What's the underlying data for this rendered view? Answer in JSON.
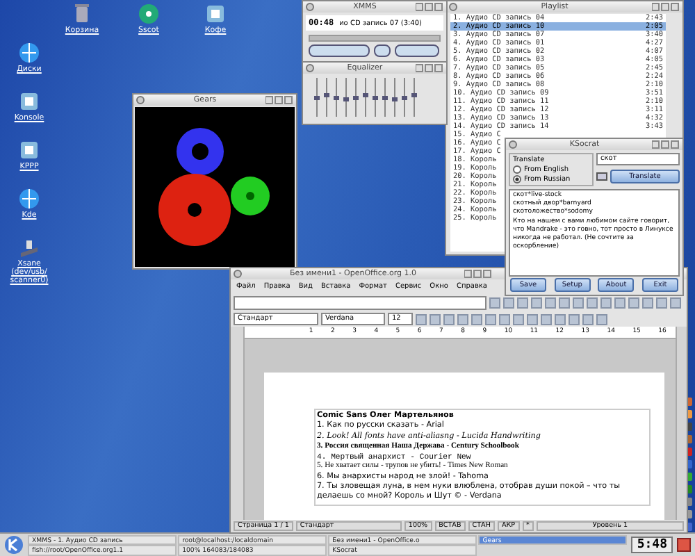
{
  "desktop_icons": [
    {
      "label": "Корзина",
      "kind": "trash"
    },
    {
      "label": "Sscot",
      "kind": "disc"
    },
    {
      "label": "Кофе",
      "kind": "app"
    },
    {
      "label": "Диски",
      "kind": "globe"
    },
    {
      "label": "Konsole",
      "kind": "app"
    },
    {
      "label": "KPPP",
      "kind": "app"
    },
    {
      "label": "Kde",
      "kind": "globe"
    },
    {
      "label": "Xsane (dev/usb/ scanner0)",
      "kind": "scanner"
    }
  ],
  "gears_window": {
    "title": "Gears"
  },
  "xmms": {
    "title": "XMMS",
    "time": "00:48",
    "song": "ио CD запись 07 (3:40)"
  },
  "equalizer": {
    "title": "Equalizer",
    "bands": [
      {
        "level": 0.5
      },
      {
        "level": 0.55
      },
      {
        "level": 0.5
      },
      {
        "level": 0.45
      },
      {
        "level": 0.5
      },
      {
        "level": 0.55
      },
      {
        "level": 0.5
      },
      {
        "level": 0.5
      },
      {
        "level": 0.45
      },
      {
        "level": 0.5
      },
      {
        "level": 0.55
      }
    ]
  },
  "playlist": {
    "title": "Playlist",
    "rows": [
      {
        "label": "1. Аудио CD запись 04",
        "time": "2:43",
        "selected": false
      },
      {
        "label": "2. Аудио CD запись 10",
        "time": "2:05",
        "selected": true
      },
      {
        "label": "3. Аудио CD запись 07",
        "time": "3:40",
        "selected": false
      },
      {
        "label": "4. Аудио CD запись 01",
        "time": "4:27",
        "selected": false
      },
      {
        "label": "5. Аудио CD запись 02",
        "time": "4:07",
        "selected": false
      },
      {
        "label": "6. Аудио CD запись 03",
        "time": "4:05",
        "selected": false
      },
      {
        "label": "7. Аудио CD запись 05",
        "time": "2:45",
        "selected": false
      },
      {
        "label": "8. Аудио CD запись 06",
        "time": "2:24",
        "selected": false
      },
      {
        "label": "9. Аудио CD запись 08",
        "time": "2:10",
        "selected": false
      },
      {
        "label": "10. Аудио CD запись 09",
        "time": "3:51",
        "selected": false
      },
      {
        "label": "11. Аудио CD запись 11",
        "time": "2:10",
        "selected": false
      },
      {
        "label": "12. Аудио CD запись 12",
        "time": "3:11",
        "selected": false
      },
      {
        "label": "13. Аудио CD запись 13",
        "time": "4:32",
        "selected": false
      },
      {
        "label": "14. Аудио CD запись 14",
        "time": "3:43",
        "selected": false
      },
      {
        "label": "15. Аудио С",
        "selected": false
      },
      {
        "label": "16. Аудио С",
        "selected": false
      },
      {
        "label": "17. Аудио С",
        "selected": false
      },
      {
        "label": "18. Король",
        "selected": false
      },
      {
        "label": "19. Король",
        "selected": false
      },
      {
        "label": "20. Король",
        "selected": false
      },
      {
        "label": "21. Король",
        "selected": false
      },
      {
        "label": "22. Король",
        "selected": false
      },
      {
        "label": "23. Король",
        "selected": false
      },
      {
        "label": "24. Король",
        "selected": false
      },
      {
        "label": "25. Король",
        "selected": false
      }
    ]
  },
  "ksocrat": {
    "title": "KSocrat",
    "group": "Translate",
    "radios": [
      {
        "label": "From English",
        "selected": false
      },
      {
        "label": "From Russian",
        "selected": true
      }
    ],
    "query": "скот",
    "translate_button": "Translate",
    "results": [
      "скот*live-stock",
      "скотный двор*barnyard",
      "скотоложество*sodomy",
      "Кто на нашем с вами любимом сайте говорит, что Mandrake - это говно, тот просто в Линуксе никогда не работал. (Не сочтите за оскорбление)"
    ],
    "buttons": [
      "Save",
      "Setup",
      "About",
      "Exit"
    ]
  },
  "writer": {
    "title": "Без имени1 - OpenOffice.org 1.0",
    "menu": [
      "Файл",
      "Правка",
      "Вид",
      "Вставка",
      "Формат",
      "Сервис",
      "Окно",
      "Справка"
    ],
    "style": "Стандарт",
    "font": "Verdana",
    "size": "12",
    "ruler": [
      "1",
      "2",
      "3",
      "4",
      "5",
      "6",
      "7",
      "8",
      "9",
      "10",
      "11",
      "12",
      "13",
      "14",
      "15",
      "16"
    ],
    "lines": [
      {
        "text": "Comic  Sans Олег Мартельянов",
        "kind": "comic"
      },
      {
        "text": "1. Как по русски сказать - Arial",
        "kind": "sans"
      },
      {
        "text": "2. Look! All fonts have anti-aliasng  -  Lucida Handwriting",
        "kind": "hand"
      },
      {
        "text": "3. Россия священная Наша Держава  -  Century Schoolbook",
        "kind": "serifbold"
      },
      {
        "text": "4. Мертвый анархист - Courier New",
        "kind": "mono"
      },
      {
        "text": "5. Не хватает силы - трупов не убить! - Times New Roman",
        "kind": "serif"
      },
      {
        "text": "6. Мы анархисты народ не злой! - Tahoma",
        "kind": "sans"
      },
      {
        "text": "7. Ты зловещая луна, в нем нуки влюблена, отобрав души покой – что ты делаешь со мной? Король и Шут ©  - Verdana",
        "kind": "sans"
      }
    ],
    "status": [
      "Страница 1 / 1",
      "Стандарт",
      "100%",
      "ВСТАВ",
      "СТАН",
      "АКР",
      "*",
      "Уровень 1"
    ]
  },
  "taskbar": {
    "tasks": [
      {
        "label": "XMMS - 1. Аудио CD запись",
        "selected": false
      },
      {
        "label": "root@localhost:/localdomain",
        "selected": false
      },
      {
        "label": "Без имени1 - OpenOffice.o",
        "selected": false
      },
      {
        "label": "Gears",
        "selected": true
      },
      {
        "label": "fish://root/OpenOffice.org1.1",
        "selected": false
      },
      {
        "label": "100% 164083/184083",
        "selected": false
      },
      {
        "label": "KSocrat",
        "selected": false
      }
    ],
    "clock": "5:48"
  }
}
